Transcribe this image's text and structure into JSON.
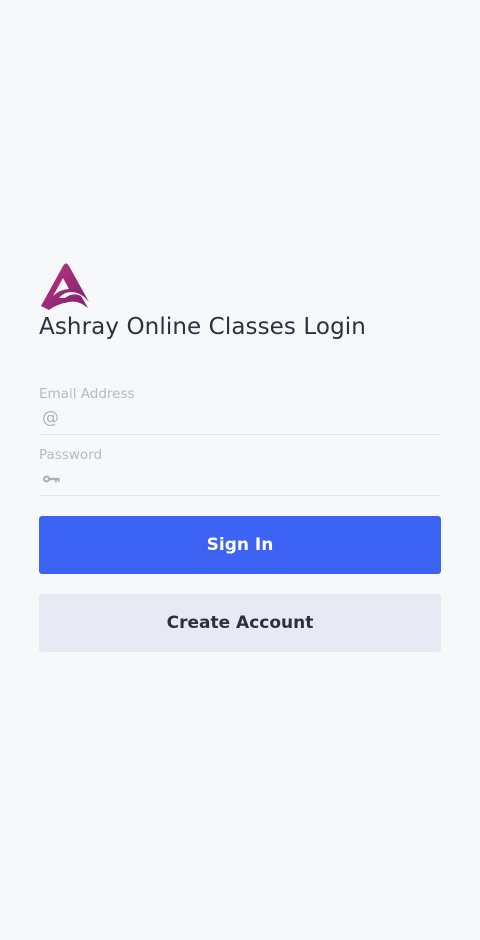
{
  "brand": {
    "title": "Ashray Online Classes Login",
    "colors": {
      "logo_start": "#c0367e",
      "logo_end": "#7a1f6e",
      "primary": "#3d63f5",
      "secondary_bg": "#e7eaf2",
      "background": "#f7f8fa"
    }
  },
  "form": {
    "email": {
      "label": "Email Address",
      "value": "",
      "icon": "at-sign-icon",
      "icon_glyph": "@"
    },
    "password": {
      "label": "Password",
      "value": "",
      "icon": "key-icon"
    },
    "sign_in_label": "Sign In",
    "create_account_label": "Create Account"
  }
}
